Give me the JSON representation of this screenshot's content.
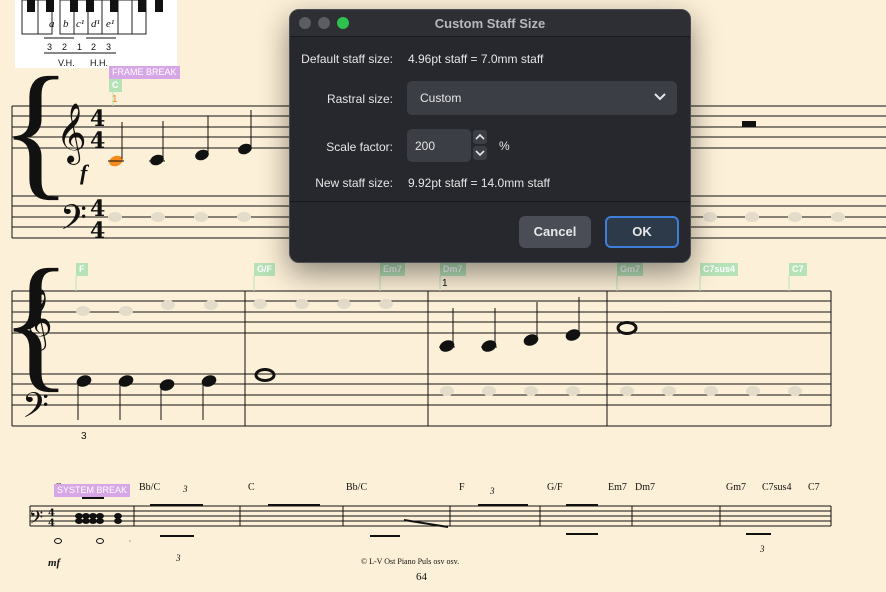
{
  "score": {
    "keyboard_note_names": [
      "a",
      "b",
      "c¹",
      "d¹",
      "e¹"
    ],
    "fingering_row": [
      "3",
      "2",
      "1",
      "2",
      "3"
    ],
    "hand_labels": [
      "V.H.",
      "H.H."
    ],
    "frame_break_label": "FRAME BREAK",
    "system_break_label": "SYSTEM BREAK",
    "rehearsal_chord": "C",
    "rehearsal_number": "1",
    "dynamic_f": "f",
    "dynamic_mf": "mf",
    "time_signature": "4",
    "system2_chords": [
      "F",
      "G/F",
      "Em7",
      "Dm7",
      "Gm7",
      "C7sus4",
      "C7"
    ],
    "system2_fingering_top": "1",
    "system2_fingering_bottom": "3",
    "system3_chords": [
      "C",
      "Bb/C",
      "C",
      "Bb/C",
      "F",
      "G/F",
      "Em7",
      "Dm7",
      "Gm7",
      "C7sus4",
      "C7"
    ],
    "tuplet_number": "3",
    "copyright": "© L-V Ost Piano Puls osv osv.",
    "page_number": "64"
  },
  "dialog": {
    "title": "Custom Staff Size",
    "default_label": "Default staff size:",
    "default_value": "4.96pt staff = 7.0mm staff",
    "rastral_label": "Rastral size:",
    "rastral_value": "Custom",
    "scale_label": "Scale factor:",
    "scale_value": "200",
    "scale_unit": "%",
    "new_label": "New staff size:",
    "new_value": "9.92pt staff = 14.0mm staff",
    "cancel_label": "Cancel",
    "ok_label": "OK",
    "colors": {
      "accent": "#3d7fd9",
      "close_light": "#2ec14d"
    }
  }
}
